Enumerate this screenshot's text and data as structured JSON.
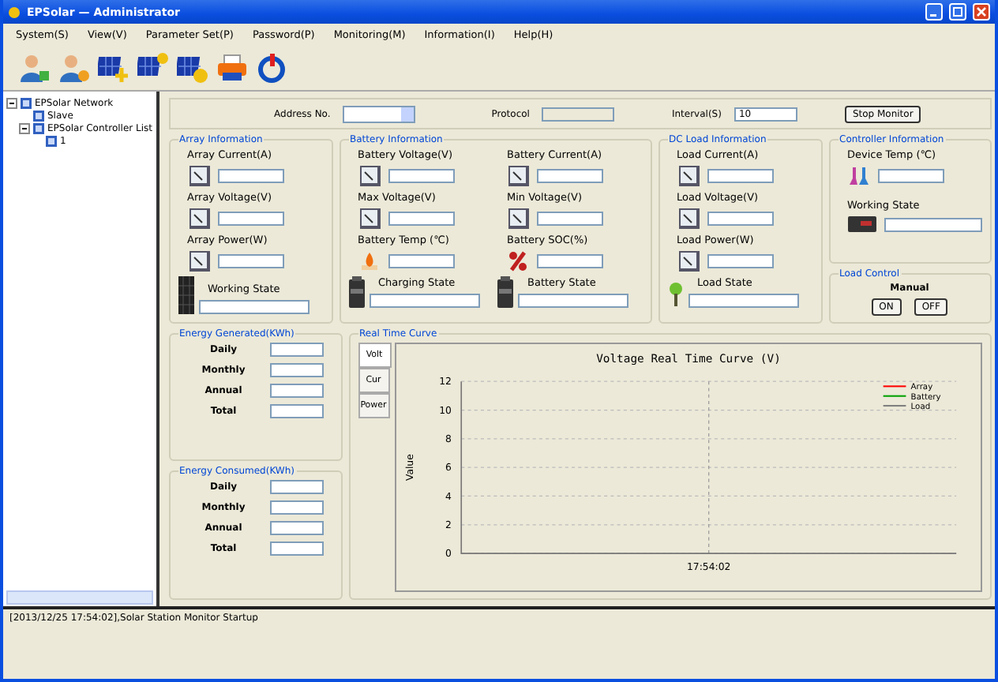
{
  "window": {
    "title": "EPSolar — Administrator"
  },
  "menu": [
    "System(S)",
    "View(V)",
    "Parameter Set(P)",
    "Password(P)",
    "Monitoring(M)",
    "Information(I)",
    "Help(H)"
  ],
  "toolbar": [
    {
      "kind": "user-add"
    },
    {
      "kind": "user-edit"
    },
    {
      "kind": "panel-add"
    },
    {
      "kind": "panel-sun"
    },
    {
      "kind": "panel-clock"
    },
    {
      "kind": "printer"
    },
    {
      "kind": "power"
    }
  ],
  "tree": [
    {
      "label": "EPSolar Network",
      "expanded": true,
      "children": [
        {
          "label": "Slave"
        },
        {
          "label": "EPSolar Controller List",
          "expanded": true,
          "children": [
            {
              "label": "1"
            }
          ]
        }
      ]
    }
  ],
  "top": {
    "address_label": "Address No.",
    "protocol_label": "Protocol",
    "interval_label": "Interval(S)",
    "interval_value": "10",
    "button": "Stop Monitor"
  },
  "array": {
    "title": "Array Information",
    "fields": [
      {
        "label": "Array Current(A)",
        "kind": "gauge"
      },
      {
        "label": "Array Voltage(V)",
        "kind": "gauge"
      },
      {
        "label": "Array Power(W)",
        "kind": "gauge"
      }
    ],
    "states": [
      {
        "label": "Working State",
        "kind": "panel"
      }
    ]
  },
  "battery": {
    "title": "Battery Information",
    "fields": [
      {
        "label": "Battery Voltage(V)",
        "kind": "gauge"
      },
      {
        "label": "Battery Current(A)",
        "kind": "gauge"
      },
      {
        "label": "Max Voltage(V)",
        "kind": "gauge"
      },
      {
        "label": "Min Voltage(V)",
        "kind": "gauge"
      },
      {
        "label": "Battery Temp (℃)",
        "kind": "flame"
      },
      {
        "label": "Battery SOC(%)",
        "kind": "percent"
      }
    ],
    "states": [
      {
        "label": "Charging State",
        "kind": "battery"
      },
      {
        "label": "Battery State",
        "kind": "battery"
      }
    ]
  },
  "load": {
    "title": "DC Load Information",
    "fields": [
      {
        "label": "Load Current(A)",
        "kind": "gauge"
      },
      {
        "label": "Load Voltage(V)",
        "kind": "gauge"
      },
      {
        "label": "Load Power(W)",
        "kind": "gauge"
      }
    ],
    "states": [
      {
        "label": "Load State",
        "kind": "lamp"
      }
    ]
  },
  "controller": {
    "title": "Controller Information",
    "fields": [
      {
        "label": "Device Temp (℃)",
        "kind": "flask"
      }
    ],
    "states": [
      {
        "label": "Working State",
        "kind": "device"
      }
    ]
  },
  "load_control": {
    "title": "Load Control",
    "mode": "Manual",
    "buttons": [
      "ON",
      "OFF"
    ]
  },
  "energy": [
    {
      "title": "Energy Generated(KWh)",
      "rows": [
        "Daily",
        "Monthly",
        "Annual",
        "Total"
      ]
    },
    {
      "title": "Energy Consumed(KWh)",
      "rows": [
        "Daily",
        "Monthly",
        "Annual",
        "Total"
      ]
    }
  ],
  "curve": {
    "title": "Real Time Curve",
    "tabs": [
      {
        "label": "Volt",
        "selected": true
      },
      {
        "label": "Cur",
        "selected": false
      },
      {
        "label": "Power",
        "selected": false
      }
    ],
    "chart_data": {
      "type": "line",
      "title": "Voltage Real Time Curve (V)",
      "ylabel": "Value",
      "categories": [
        "17:54:02"
      ],
      "ylim": [
        0,
        12
      ],
      "grid": true,
      "ref_lines": [
        {
          "axis": "x",
          "value": "17:54:02"
        }
      ],
      "yticks": [
        0,
        2,
        4,
        6,
        8,
        10,
        12
      ],
      "series": [
        {
          "name": "Array",
          "color": "#ff0000",
          "values": [
            null
          ]
        },
        {
          "name": "Battery",
          "color": "#00a000",
          "values": [
            null
          ]
        },
        {
          "name": "Load",
          "color": "#808080",
          "values": [
            null
          ]
        }
      ]
    }
  },
  "log": [
    "[2013/12/25 17:54:02],Solar Station Monitor Startup"
  ]
}
